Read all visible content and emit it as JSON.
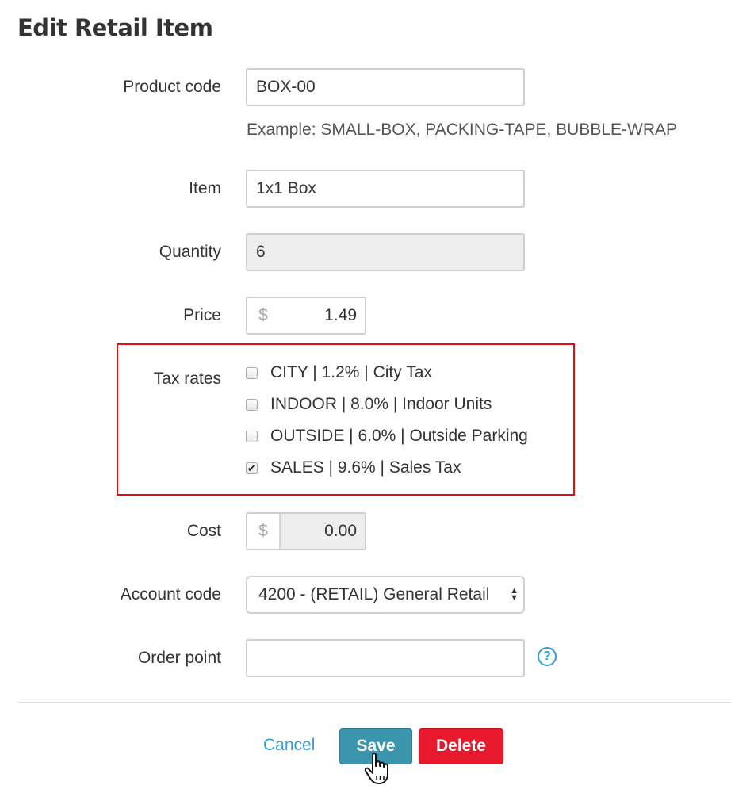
{
  "page": {
    "title": "Edit Retail Item"
  },
  "form": {
    "product_code": {
      "label": "Product code",
      "value": "BOX-00",
      "help": "Example: SMALL-BOX, PACKING-TAPE, BUBBLE-WRAP"
    },
    "item": {
      "label": "Item",
      "value": "1x1 Box"
    },
    "quantity": {
      "label": "Quantity",
      "value": "6"
    },
    "price": {
      "label": "Price",
      "currency": "$",
      "value": "1.49"
    },
    "tax_rates": {
      "label": "Tax rates",
      "options": [
        {
          "label": "CITY | 1.2% | City Tax",
          "checked": false
        },
        {
          "label": "INDOOR | 8.0% | Indoor Units",
          "checked": false
        },
        {
          "label": "OUTSIDE | 6.0% | Outside Parking",
          "checked": false
        },
        {
          "label": "SALES | 9.6% | Sales Tax",
          "checked": true
        }
      ],
      "highlight_color": "#e01010"
    },
    "cost": {
      "label": "Cost",
      "currency": "$",
      "value": "0.00"
    },
    "account_code": {
      "label": "Account code",
      "selected": "4200 - (RETAIL) General Retail"
    },
    "order_point": {
      "label": "Order point",
      "value": "",
      "help_icon": "question-circle-icon"
    }
  },
  "actions": {
    "cancel": "Cancel",
    "save": "Save",
    "delete": "Delete"
  },
  "colors": {
    "link": "#2f9fd8",
    "save": "#3a95ad",
    "delete": "#e8192c"
  }
}
